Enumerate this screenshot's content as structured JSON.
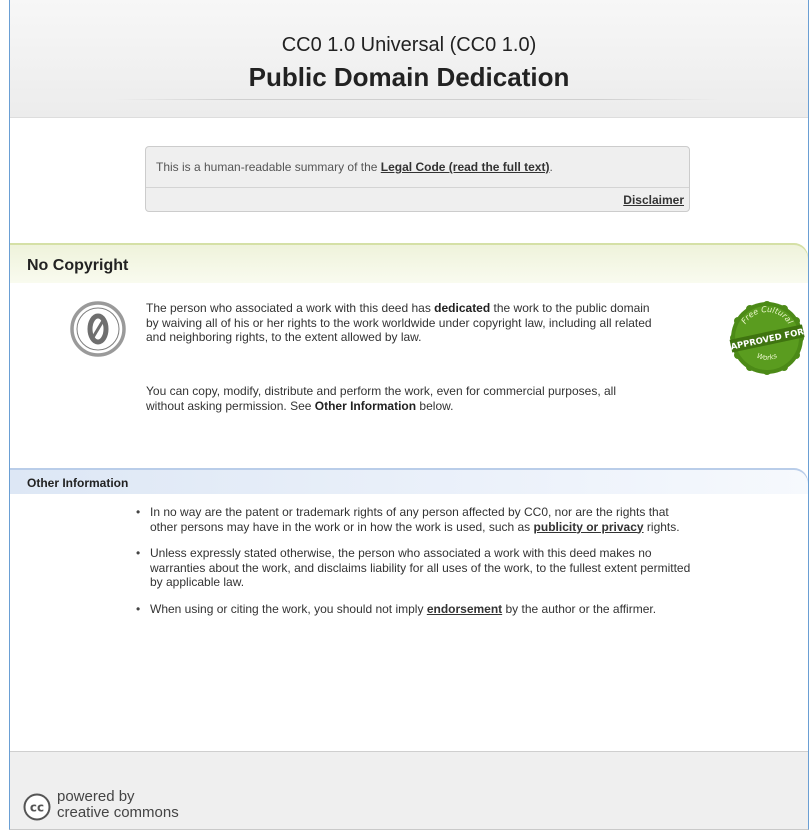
{
  "header": {
    "title_line1": "CC0 1.0 Universal (CC0 1.0)",
    "title_line2": "Public Domain Dedication"
  },
  "summary": {
    "text_before": "This is a human-readable summary of the ",
    "legal_code_link": "Legal Code (read the full text)",
    "text_after": ".",
    "disclaimer_link": "Disclaimer"
  },
  "no_copyright": {
    "heading": "No Copyright",
    "p1_a": "The person who associated a work with this deed has ",
    "p1_b": "dedicated",
    "p1_c": " the work to the public domain by waiving all of his or her rights to the work worldwide under copyright law, including all related and neighboring rights, to the extent allowed by law.",
    "p2_a": "You can copy, modify, distribute and perform the work, even for commercial purposes, all without asking permission. See ",
    "p2_b": "Other Information",
    "p2_c": " below.",
    "badge_text_top": "Free Cultural",
    "badge_text_mid": "APPROVED FOR",
    "badge_text_bottom": "Works"
  },
  "other_info": {
    "heading": "Other Information",
    "b1_a": "In no way are the patent or trademark rights of any person affected by CC0, nor are the rights that other persons may have in the work or in how the work is used, such as ",
    "b1_link": "publicity or privacy",
    "b1_c": " rights.",
    "b2": "Unless expressly stated otherwise, the person who associated a work with this deed makes no warranties about the work, and disclaims liability for all uses of the work, to the fullest extent permitted by applicable law.",
    "b3_a": "When using or citing the work, you should not imply ",
    "b3_link": "endorsement",
    "b3_c": " by the author or the affirmer."
  },
  "footer": {
    "cc_logo_text": "cc",
    "powered_line1": "powered by",
    "powered_line2": "creative commons"
  },
  "colors": {
    "green_band": "#eef2da",
    "blue_band": "#dde7f5",
    "badge_green": "#4c8a17",
    "frame_border": "#6a9fd4"
  },
  "icons": [
    "cc-zero-icon",
    "approved-for-free-cultural-works-badge",
    "cc-logo-icon"
  ]
}
